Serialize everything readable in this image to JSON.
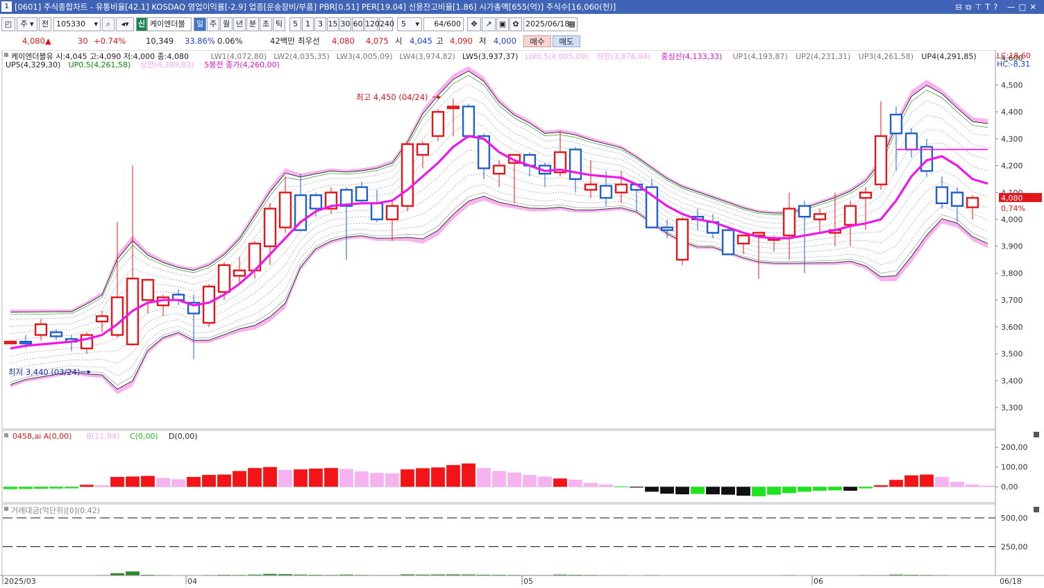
{
  "window": {
    "no": "1",
    "title": "[0601] 주식종합차트 - 유통비율[42.1] KOSDAQ 영업이익률[-2.9] 업종[운송장비/부품] PBR[0.51] PER[19.04] 신용잔고비율[1.86] 시가총액[655(억)] 주식수[16,060(천)]",
    "controls": "⊟⧉⊤T?  —□✕"
  },
  "toolbar": {
    "period": "주",
    "prev": "전",
    "code": "105330",
    "name_badge": "신",
    "name": "케이엔더블",
    "tabs": [
      "일",
      "주",
      "월",
      "년",
      "분",
      "초",
      "틱"
    ],
    "active_tab": "일",
    "intervals": [
      "5",
      "1",
      "3",
      "15",
      "30",
      "60",
      "120",
      "240"
    ],
    "interval_sel": "5",
    "count": "64",
    "count_total": "/600",
    "date": "2025/06/18",
    "buy": "매수",
    "sell": "매도"
  },
  "quote": {
    "price": "4,080",
    "arrow": "▲",
    "change": "30",
    "pct": "+0.74%",
    "volume": "10,349",
    "vol_ratio": "33.86%",
    "turnover": "0.06%",
    "amount": "42백만",
    "best_label": "최우선",
    "best_ask": "4,080",
    "best_bid": "4,075",
    "open_l": "시",
    "open": "4,045",
    "high_l": "고",
    "high": "4,090",
    "low_l": "저",
    "low": "4,000"
  },
  "legend": {
    "row1": [
      [
        "케이엔더블유 시:4,045 고:4,090 저:4,000 종:4,080",
        "#222"
      ],
      [
        "LW1(4,072,80)",
        "#777"
      ],
      [
        "LW2(4,035,35)",
        "#777"
      ],
      [
        "LW3(4,005,09)",
        "#777"
      ],
      [
        "LW4(3,974,82)",
        "#777"
      ],
      [
        "LW5(3,937,37)",
        "#222"
      ],
      [
        "LW0.5(4,005,09)",
        "#f7a8f0"
      ],
      [
        "하한(3,876,84)",
        "#f7a8f0"
      ],
      [
        "중심선(4,133,33)",
        "#e010d0"
      ],
      [
        "UP1(4,193,87)",
        "#777"
      ],
      [
        "UP2(4,231,31)",
        "#777"
      ],
      [
        "UP3(4,261,58)",
        "#777"
      ],
      [
        "UP4(4,291,85)",
        "#222"
      ]
    ],
    "row2": [
      [
        "UP5(4,329,30)",
        "#222"
      ],
      [
        "UP0.5(4,261,58)",
        "#0a8a0a"
      ],
      [
        "상한(4,389,83)",
        "#f7a8f0"
      ],
      [
        "5봉전 종가(4,260,00)",
        "#e010d0"
      ]
    ],
    "lc": "LC:18,60",
    "hc": "HC:-8,31",
    "hi_note": "최고 4,450 (04/24)",
    "lo_note": "최저 3,440 (03/24)",
    "last_price": "4,080",
    "last_pct": "0,74%"
  },
  "osc_legend": [
    [
      "0458,ai A(0,00)",
      "#e3141a"
    ],
    [
      "B(11,94)",
      "#f7a8f0"
    ],
    [
      "C(0,00)",
      "#17c017"
    ],
    [
      "D(0,00)",
      "#222"
    ]
  ],
  "vol_legend": "거래대금(억단위)[0](0,42)",
  "xlabels": [
    {
      "t": "2025/03",
      "i": 0
    },
    {
      "t": "04",
      "i": 12
    },
    {
      "t": "05",
      "i": 34
    },
    {
      "t": "06",
      "i": 53
    }
  ],
  "xlabel_end": "06/18",
  "colors": {
    "up": "#e3141a",
    "down": "#1f5fc8",
    "center": "#f016e8",
    "band": "#f7b2ef",
    "osc_pos": "#f41417",
    "osc_pos_weak": "#f7b3ef",
    "osc_neg": "#111",
    "osc_neg_weak": "#1ee41e"
  },
  "chart_data": [
    {
      "type": "candlestick",
      "title": "케이엔더블유",
      "ylim": [
        3220,
        4620
      ],
      "yticks": [
        3300,
        3400,
        3500,
        3600,
        3700,
        3800,
        3900,
        4000,
        4100,
        4200,
        4300,
        4400,
        4500,
        4600
      ],
      "ohlc": [
        [
          3545,
          3545,
          3545,
          3545
        ],
        [
          3545,
          3570,
          3520,
          3540
        ],
        [
          3570,
          3630,
          3550,
          3610
        ],
        [
          3580,
          3590,
          3550,
          3565
        ],
        [
          3555,
          3570,
          3510,
          3545
        ],
        [
          3520,
          3580,
          3500,
          3570
        ],
        [
          3620,
          3660,
          3580,
          3640
        ],
        [
          3570,
          3990,
          3560,
          3710
        ],
        [
          3535,
          4200,
          3530,
          3780
        ],
        [
          3700,
          3780,
          3650,
          3775
        ],
        [
          3680,
          3720,
          3640,
          3710
        ],
        [
          3720,
          3740,
          3680,
          3700
        ],
        [
          3690,
          3720,
          3480,
          3650
        ],
        [
          3615,
          3760,
          3600,
          3750
        ],
        [
          3730,
          3840,
          3700,
          3830
        ],
        [
          3790,
          3860,
          3760,
          3810
        ],
        [
          3810,
          3920,
          3780,
          3910
        ],
        [
          3900,
          4060,
          3830,
          4040
        ],
        [
          3970,
          4160,
          3950,
          4100
        ],
        [
          4090,
          4170,
          3960,
          3960
        ],
        [
          4090,
          4100,
          4010,
          4040
        ],
        [
          4040,
          4120,
          4020,
          4100
        ],
        [
          4110,
          4120,
          3850,
          4050
        ],
        [
          4120,
          4140,
          4060,
          4070
        ],
        [
          4060,
          4110,
          3990,
          4000
        ],
        [
          4000,
          4070,
          3920,
          4050
        ],
        [
          4050,
          4290,
          4030,
          4280
        ],
        [
          4240,
          4290,
          4190,
          4280
        ],
        [
          4310,
          4410,
          4290,
          4400
        ],
        [
          4415,
          4450,
          4310,
          4420
        ],
        [
          4420,
          4430,
          4300,
          4310
        ],
        [
          4310,
          4320,
          4150,
          4190
        ],
        [
          4170,
          4220,
          4120,
          4200
        ],
        [
          4210,
          4240,
          4060,
          4240
        ],
        [
          4240,
          4250,
          4160,
          4200
        ],
        [
          4200,
          4210,
          4120,
          4170
        ],
        [
          4175,
          4330,
          4160,
          4250
        ],
        [
          4260,
          4270,
          4100,
          4150
        ],
        [
          4110,
          4220,
          4080,
          4130
        ],
        [
          4125,
          4180,
          4050,
          4080
        ],
        [
          4100,
          4180,
          4060,
          4130
        ],
        [
          4130,
          4130,
          4030,
          4110
        ],
        [
          4120,
          4150,
          3970,
          3970
        ],
        [
          3970,
          4000,
          3930,
          3960
        ],
        [
          3850,
          4010,
          3830,
          4000
        ],
        [
          4010,
          4040,
          3960,
          4000
        ],
        [
          3990,
          4020,
          3930,
          3950
        ],
        [
          3960,
          3970,
          3880,
          3870
        ],
        [
          3910,
          3940,
          3870,
          3940
        ],
        [
          3940,
          3950,
          3780,
          3950
        ],
        [
          3930,
          3940,
          3880,
          3930
        ],
        [
          3940,
          4100,
          3850,
          4040
        ],
        [
          4050,
          4070,
          3800,
          4010
        ],
        [
          4000,
          4040,
          3950,
          4020
        ],
        [
          3950,
          4100,
          3900,
          3960
        ],
        [
          3980,
          4070,
          3900,
          4050
        ],
        [
          4080,
          4120,
          3960,
          4100
        ],
        [
          4130,
          4440,
          4110,
          4310
        ],
        [
          4390,
          4420,
          4180,
          4320
        ],
        [
          4320,
          4340,
          4230,
          4260
        ],
        [
          4270,
          4300,
          4160,
          4180
        ],
        [
          4120,
          4160,
          4040,
          4060
        ],
        [
          4100,
          4120,
          3990,
          4050
        ],
        [
          4045,
          4090,
          4000,
          4080
        ]
      ],
      "center": [
        3520,
        3530,
        3535,
        3540,
        3545,
        3555,
        3570,
        3610,
        3660,
        3690,
        3700,
        3700,
        3680,
        3690,
        3720,
        3760,
        3810,
        3870,
        3930,
        3990,
        4030,
        4050,
        4055,
        4060,
        4060,
        4070,
        4110,
        4160,
        4210,
        4270,
        4310,
        4300,
        4250,
        4220,
        4200,
        4180,
        4185,
        4175,
        4165,
        4160,
        4155,
        4130,
        4090,
        4050,
        4020,
        4000,
        3990,
        3970,
        3950,
        3935,
        3930,
        3930,
        3940,
        3950,
        3960,
        3975,
        3985,
        4000,
        4070,
        4160,
        4220,
        4235,
        4200,
        4150,
        4133
      ],
      "bands": {
        "outer": [
          145,
          135,
          130,
          125,
          120,
          140,
          160,
          260,
          280,
          190,
          150,
          130,
          140,
          150,
          160,
          180,
          220,
          250,
          260,
          180,
          150,
          140,
          130,
          130,
          140,
          150,
          190,
          250,
          270,
          270,
          260,
          230,
          200,
          180,
          170,
          150,
          150,
          150,
          140,
          130,
          120,
          110,
          110,
          110,
          110,
          110,
          100,
          100,
          100,
          100,
          100,
          100,
          110,
          120,
          130,
          140,
          170,
          230,
          300,
          320,
          300,
          250,
          230,
          230,
          240
        ],
        "inner": [
          0.2,
          0.38,
          0.56,
          0.74,
          0.87,
          0.93
        ]
      },
      "fixed_line": {
        "value": 4260,
        "from": 58
      },
      "markers": [
        {
          "label": "최고 4,450 (04/24)",
          "index": 29,
          "value": 4450
        },
        {
          "label": "최저 3,440 (03/24)",
          "index": 6,
          "value": 3440
        }
      ]
    },
    {
      "type": "bar",
      "title": "0458,ai",
      "ylim": [
        -80,
        250
      ],
      "yticks": [
        0,
        100,
        200
      ],
      "values": [
        -12,
        -11,
        -10,
        -9,
        -8,
        10,
        8,
        50,
        52,
        55,
        45,
        38,
        50,
        60,
        62,
        80,
        95,
        100,
        85,
        88,
        92,
        95,
        90,
        78,
        70,
        68,
        88,
        94,
        98,
        110,
        118,
        95,
        80,
        72,
        60,
        52,
        42,
        36,
        20,
        12,
        2,
        -4,
        -25,
        -35,
        -38,
        -36,
        -38,
        -40,
        -45,
        -48,
        -40,
        -32,
        -25,
        -20,
        -18,
        -20,
        -8,
        8,
        35,
        58,
        62,
        50,
        25,
        12,
        6
      ],
      "kind": [
        "g",
        "g",
        "g",
        "g",
        "g",
        "r",
        "p",
        "r",
        "r",
        "r",
        "p",
        "p",
        "r",
        "r",
        "r",
        "r",
        "r",
        "r",
        "p",
        "r",
        "r",
        "r",
        "p",
        "p",
        "p",
        "p",
        "r",
        "r",
        "r",
        "r",
        "r",
        "p",
        "p",
        "p",
        "p",
        "p",
        "r",
        "p",
        "p",
        "p",
        "g",
        "k",
        "k",
        "k",
        "k",
        "g",
        "k",
        "k",
        "k",
        "g",
        "g",
        "g",
        "g",
        "g",
        "g",
        "k",
        "g",
        "r",
        "r",
        "r",
        "r",
        "p",
        "p",
        "p",
        "p"
      ]
    },
    {
      "type": "bar",
      "title": "거래대금(억단위)",
      "ylim": [
        0,
        560
      ],
      "yticks": [
        250,
        500
      ],
      "values": [
        3,
        3,
        3,
        3,
        2,
        2,
        4,
        20,
        35,
        6,
        4,
        3,
        3,
        4,
        6,
        5,
        8,
        14,
        12,
        8,
        6,
        5,
        8,
        5,
        4,
        4,
        10,
        8,
        9,
        10,
        9,
        7,
        6,
        5,
        4,
        4,
        8,
        6,
        5,
        4,
        4,
        3,
        4,
        3,
        3,
        3,
        3,
        3,
        3,
        3,
        3,
        4,
        3,
        3,
        3,
        3,
        4,
        4,
        8,
        6,
        5,
        4,
        3,
        3,
        3
      ]
    }
  ]
}
